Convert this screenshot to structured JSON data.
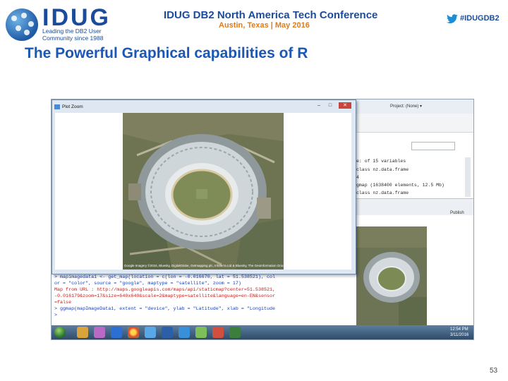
{
  "header": {
    "logo_text": "IDUG",
    "tagline_line1": "Leading the DB2 User",
    "tagline_line2": "Community since 1988",
    "conference_title": "IDUG DB2 North America Tech Conference",
    "conference_subtitle": "Austin, Texas  |  May 2016",
    "hashtag": "#IDUGDB2"
  },
  "slide": {
    "title": "The Powerful Graphical capabilities of R",
    "page_number": "53"
  },
  "plot_zoom": {
    "window_title": "Plot Zoom",
    "minimize_label": "–",
    "maximize_label": "□",
    "close_label": "✕",
    "map_credit": "Google  Imagery ©2016, Bluesky, DigitalGlobe, Getmapping plc, Infoterra Ltd & Bluesky, The GeoInformation Group"
  },
  "rstudio": {
    "project_label": "Project: (None) ▾",
    "environment_rows": [
      "e:  of 15 variables",
      "class nz.data.frame",
      "  4",
      "gmap (1638400 elements, 12.5 Mb)",
      "class nz.data.frame"
    ],
    "publish_label": "Publish"
  },
  "console": {
    "lines": [
      {
        "text": "> mapimagedata1 <- get_map(location = c(lon = -0.016670, lat = 51.538521), col",
        "kind": "cmd"
      },
      {
        "text": "or = \"color\", source = \"google\", maptype = \"satellite\", zoom = 17)",
        "kind": "cmd"
      },
      {
        "text": "Map from URL : http://maps.googleapis.com/maps/api/staticmap?center=51.538521,",
        "kind": "msg"
      },
      {
        "text": "-0.016179&zoom=17&size=640x640&scale=2&maptype=satellite&language=en-EN&sensor",
        "kind": "msg"
      },
      {
        "text": "=false",
        "kind": "msg"
      },
      {
        "text": "> ggmap(mapImageData1, extent = \"device\", ylab = \"Latitude\", xlab = \"Longitude",
        "kind": "cmd"
      },
      {
        "text": ">",
        "kind": "cmd"
      }
    ]
  },
  "taskbar": {
    "time": "12:54 PM",
    "date": "3/11/2016"
  },
  "colors": {
    "brand_blue": "#1a4c9b",
    "title_blue": "#1b57b5",
    "accent_orange": "#e07b1a"
  }
}
